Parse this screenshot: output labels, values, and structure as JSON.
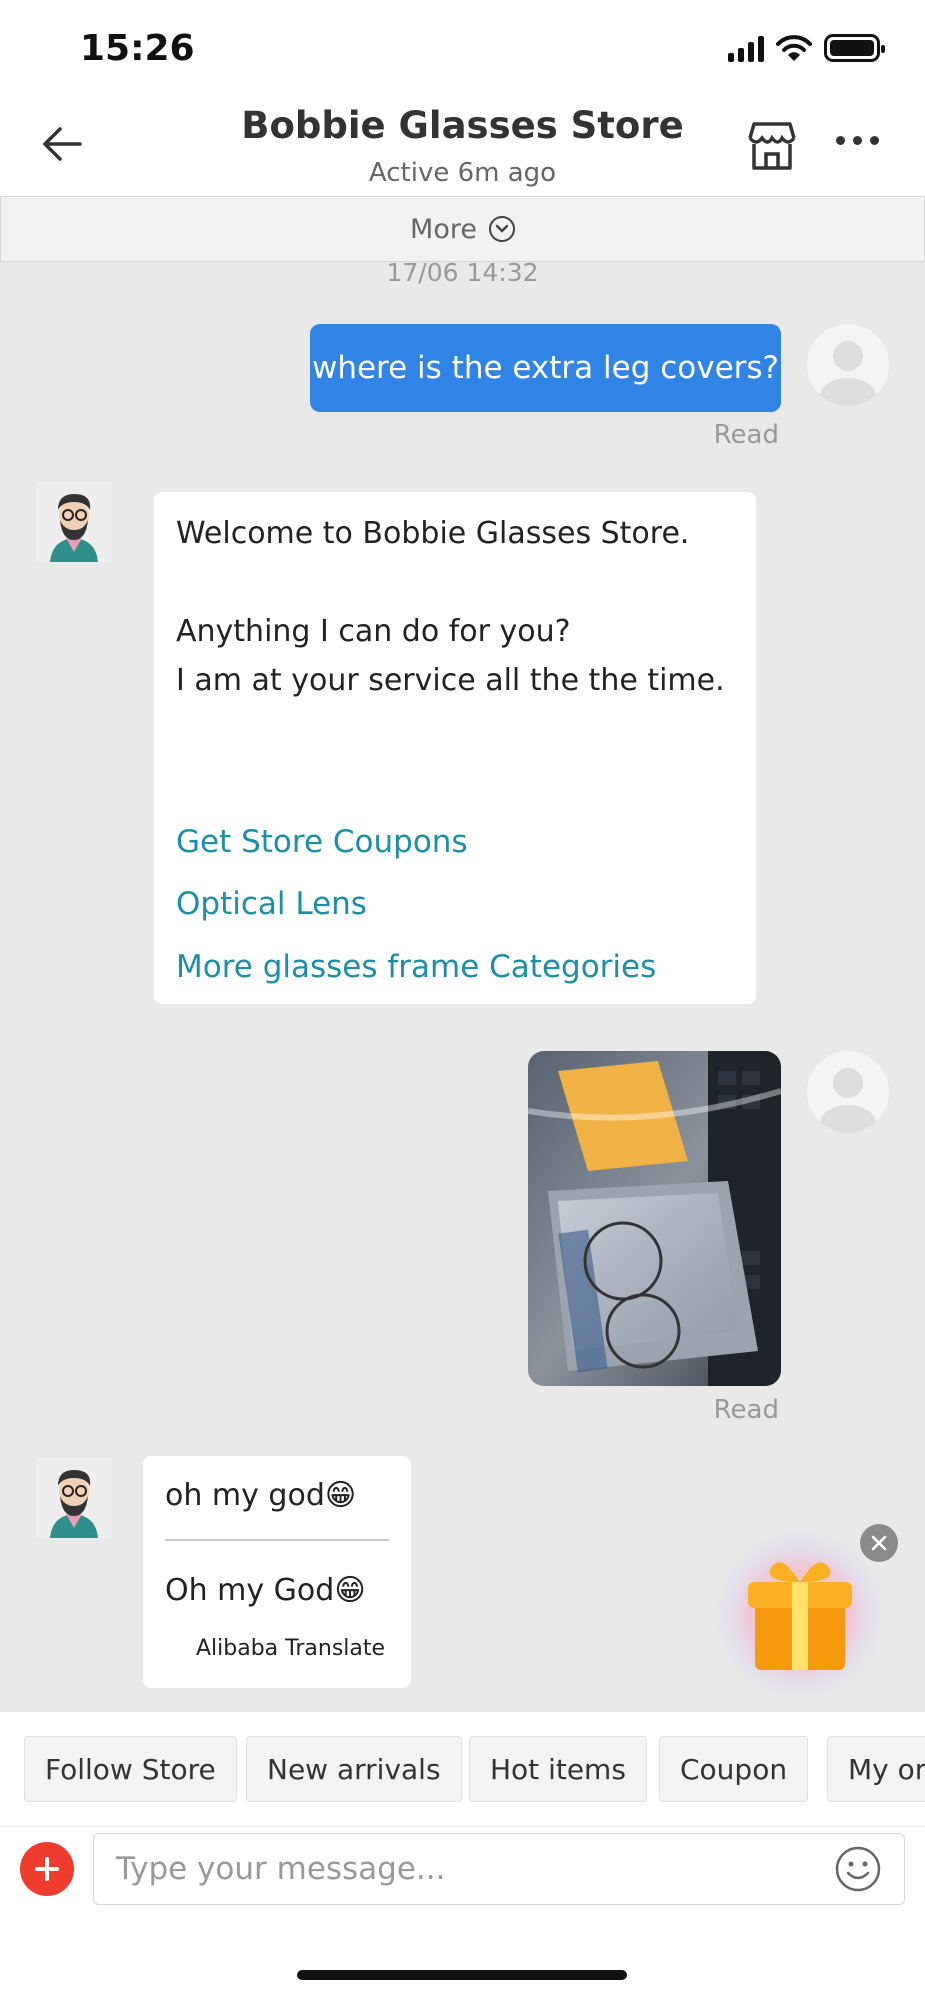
{
  "status_bar": {
    "time": "15:26"
  },
  "header": {
    "title": "Bobbie Glasses Store",
    "subtitle": "Active 6m ago",
    "back_icon": "arrow-left-icon",
    "store_icon": "storefront-icon",
    "menu_icon": "more-horizontal-icon"
  },
  "more_bar": {
    "label": "More"
  },
  "chat": {
    "timestamp": "17/06 14:32",
    "messages": [
      {
        "from": "user",
        "text": "where is the extra leg covers?",
        "status": "Read"
      },
      {
        "from": "store",
        "lines": [
          "Welcome to Bobbie Glasses Store.",
          "Anything I can do for you?",
          "I am at your service all the the time."
        ],
        "links": [
          "Get Store Coupons",
          "Optical Lens",
          "More glasses frame Categories"
        ]
      },
      {
        "from": "user",
        "type": "image",
        "status": "Read"
      },
      {
        "from": "store",
        "text": "oh my god😁",
        "translation": "Oh my God😁",
        "translation_label": "Alibaba Translate"
      }
    ]
  },
  "quick_chips": [
    "Follow Store",
    "New arrivals",
    "Hot items",
    "Coupon",
    "My orders"
  ],
  "composer": {
    "placeholder": "Type your message..."
  },
  "colors": {
    "accent_blue": "#2f84e6",
    "link": "#1a8fa8",
    "plus_red": "#f03c2e"
  }
}
